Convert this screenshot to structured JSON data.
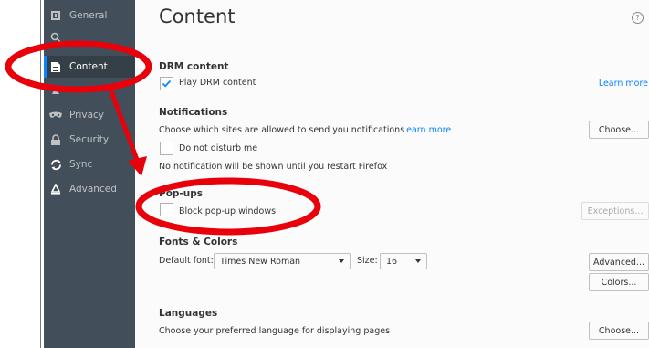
{
  "sidebar": {
    "items": [
      {
        "label": "General",
        "icon": "general-icon",
        "active": false
      },
      {
        "label": "",
        "icon": "search-icon",
        "active": false
      },
      {
        "label": "Content",
        "icon": "content-icon",
        "active": true
      },
      {
        "label": "",
        "icon": "applications-icon",
        "active": false
      },
      {
        "label": "Privacy",
        "icon": "privacy-mask-icon",
        "active": false
      },
      {
        "label": "Security",
        "icon": "security-lock-icon",
        "active": false
      },
      {
        "label": "Sync",
        "icon": "sync-icon",
        "active": false
      },
      {
        "label": "Advanced",
        "icon": "advanced-icon",
        "active": false
      }
    ]
  },
  "main": {
    "title": "Content",
    "help_icon": "?",
    "drm": {
      "heading": "DRM content",
      "checkbox_label": "Play DRM content",
      "checked": true,
      "learn_more": "Learn more"
    },
    "notifications": {
      "heading": "Notifications",
      "description": "Choose which sites are allowed to send you notifications",
      "learn_more": "Learn more",
      "choose_button": "Choose...",
      "dnd_label": "Do not disturb me",
      "dnd_checked": false,
      "note": "No notification will be shown until you restart Firefox"
    },
    "popups": {
      "heading": "Pop-ups",
      "checkbox_label": "Block pop-up windows",
      "checked": false,
      "exceptions_button": "Exceptions..."
    },
    "fonts": {
      "heading": "Fonts & Colors",
      "default_font_label": "Default font:",
      "default_font_value": "Times New Roman",
      "size_label": "Size:",
      "size_value": "16",
      "advanced_button": "Advanced...",
      "colors_button": "Colors..."
    },
    "languages": {
      "heading": "Languages",
      "description": "Choose your preferred language for displaying pages",
      "choose_button": "Choose..."
    }
  },
  "colors": {
    "annotation": "#e8000b",
    "accent": "#0a84ff",
    "sidebar_bg": "#424f5a"
  }
}
